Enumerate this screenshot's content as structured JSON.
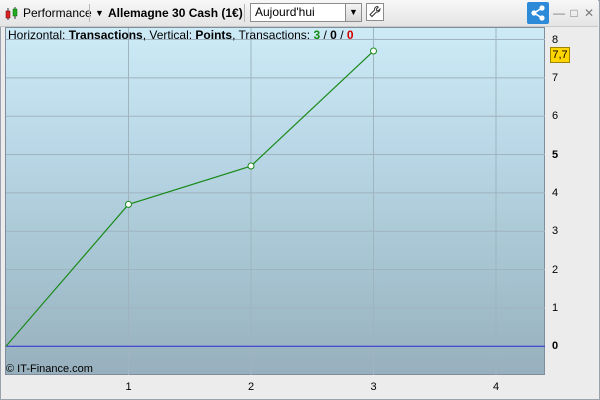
{
  "toolbar": {
    "app_label": "Performance",
    "instrument": "Allemagne 30 Cash (1€)",
    "period": {
      "selected": "Aujourd'hui"
    },
    "window_controls": {
      "minimize": "—",
      "restore": "□",
      "close": "✕"
    }
  },
  "info": {
    "horizontal_label": "Horizontal: ",
    "horizontal_value": "Transactions",
    "vertical_label": ", Vertical: ",
    "vertical_value": "Points",
    "transactions_label": ", Transactions: ",
    "tx_total": "3",
    "slash1": " / ",
    "tx_zero": "0",
    "slash2": " / ",
    "tx_loss": "0"
  },
  "copyright": "© IT-Finance.com",
  "last_value_badge": "7,7",
  "colors": {
    "line": "#1a8a1a",
    "baseline": "#2a2ad8",
    "badge": "#ffd500",
    "share": "#2c8ad8"
  },
  "chart_data": {
    "type": "line",
    "x": [
      0,
      1,
      2,
      3
    ],
    "y": [
      0,
      3.7,
      4.7,
      7.7
    ],
    "xlim": [
      0,
      4.4
    ],
    "ylim": [
      -0.75,
      8.3
    ],
    "x_ticks": [
      "1",
      "2",
      "3",
      "4"
    ],
    "y_ticks": [
      "0",
      "1",
      "2",
      "3",
      "4",
      "5",
      "6",
      "7",
      "8"
    ],
    "grid": true,
    "baseline": 0
  }
}
